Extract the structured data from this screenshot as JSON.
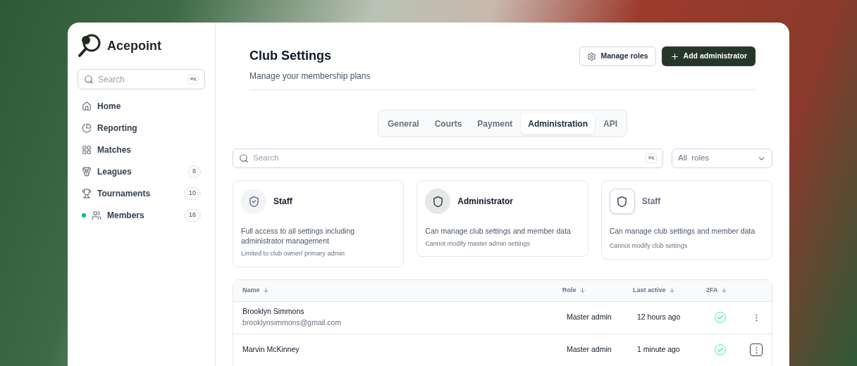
{
  "brand": {
    "name": "Acepoint"
  },
  "sidebar": {
    "search": {
      "placeholder": "Search",
      "shortcut": "⌘K"
    },
    "items": [
      {
        "label": "Home",
        "current": false
      },
      {
        "label": "Reporting",
        "current": false
      },
      {
        "label": "Matches",
        "current": false
      },
      {
        "label": "Leagues",
        "badge": "8",
        "current": false
      },
      {
        "label": "Tournaments",
        "badge": "10",
        "current": false
      },
      {
        "label": "Members",
        "badge": "16",
        "current": true
      }
    ]
  },
  "header": {
    "title": "Club Settings",
    "subtitle": "Manage your membership plans",
    "buttons": [
      {
        "label": "Manage roles",
        "kind": "secondary"
      },
      {
        "label": "Add administrator",
        "kind": "primary"
      }
    ]
  },
  "tabs": [
    {
      "label": "General",
      "selected": false
    },
    {
      "label": "Courts",
      "selected": false
    },
    {
      "label": "Payment",
      "selected": false
    },
    {
      "label": "Administration",
      "selected": true
    },
    {
      "label": "API",
      "selected": false
    }
  ],
  "filters": {
    "search": {
      "placeholder": "Search",
      "shortcut": "⌘K"
    },
    "role_select": {
      "value": "All  roles"
    }
  },
  "role_cards": [
    {
      "title": "Staff",
      "kind": "check",
      "description": "Full access to all settings including administrator management",
      "note": "Limited to club owner/ primary admin"
    },
    {
      "title": "Administrator",
      "kind": "filled",
      "description": "Can manage club settings and member data",
      "note": "Cannot modify master admin settings"
    },
    {
      "title": "Staff",
      "kind": "outline",
      "description": "Can manage club settings and member data",
      "note": "Cannot modify club settings"
    }
  ],
  "table": {
    "columns": [
      "Name",
      "Role",
      "Last active",
      "2FA"
    ],
    "rows": [
      {
        "name": "Brooklyn Simmons",
        "email": "brooklynsimmons@gmail.com",
        "role": "Master admin",
        "last_active": "12 hours ago",
        "two_fa": true,
        "focused": false
      },
      {
        "name": "Marvin McKinney",
        "role": "Master admin",
        "last_active": "1 minute ago",
        "two_fa": true,
        "focused": true
      }
    ]
  }
}
